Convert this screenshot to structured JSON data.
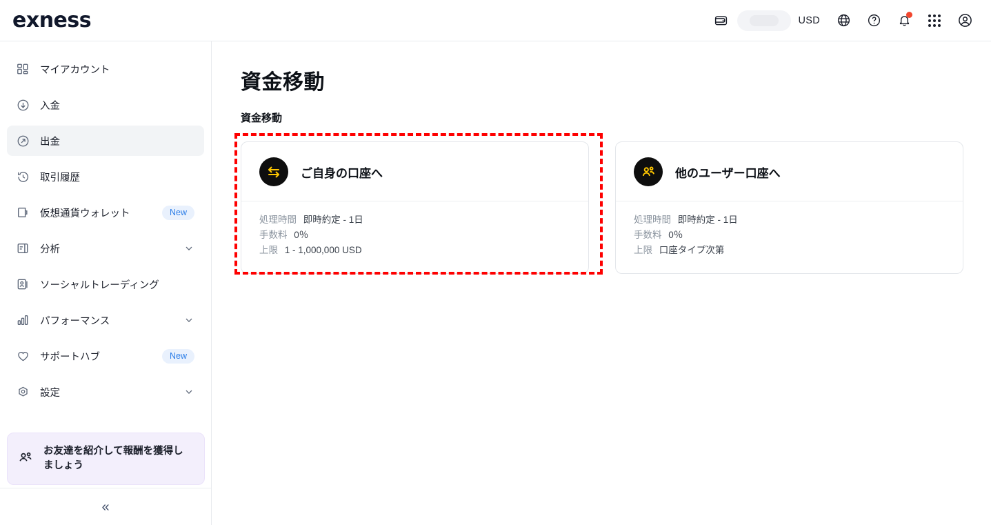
{
  "header": {
    "logo": "exness",
    "currency": "USD",
    "icons": {
      "wallet": "wallet-icon",
      "skeleton": "balance-loading-placeholder",
      "globe": "globe-icon",
      "help": "help-circle-icon",
      "notifications": "bell-icon",
      "apps": "apps-grid-icon",
      "account": "account-avatar-icon"
    }
  },
  "sidebar": {
    "items": [
      {
        "label": "マイアカウント",
        "icon": "dashboard-icon",
        "badge": null,
        "chevron": false,
        "active": false
      },
      {
        "label": "入金",
        "icon": "deposit-arrow-down-icon",
        "badge": null,
        "chevron": false,
        "active": false
      },
      {
        "label": "出金",
        "icon": "withdraw-arrow-up-right-icon",
        "badge": null,
        "chevron": false,
        "active": true
      },
      {
        "label": "取引履歴",
        "icon": "history-clock-icon",
        "badge": null,
        "chevron": false,
        "active": false
      },
      {
        "label": "仮想通貨ウォレット",
        "icon": "crypto-wallet-icon",
        "badge": "New",
        "chevron": false,
        "active": false
      },
      {
        "label": "分析",
        "icon": "analytics-icon",
        "badge": null,
        "chevron": true,
        "active": false
      },
      {
        "label": "ソーシャルトレーディング",
        "icon": "social-trading-icon",
        "badge": null,
        "chevron": false,
        "active": false
      },
      {
        "label": "パフォーマンス",
        "icon": "performance-bars-icon",
        "badge": null,
        "chevron": true,
        "active": false
      },
      {
        "label": "サポートハブ",
        "icon": "heart-icon",
        "badge": "New",
        "chevron": false,
        "active": false
      },
      {
        "label": "設定",
        "icon": "settings-gear-icon",
        "badge": null,
        "chevron": true,
        "active": false
      }
    ],
    "referral": {
      "text": "お友達を紹介して報酬を獲得しましょう",
      "icon": "people-icon"
    },
    "collapse": "«"
  },
  "main": {
    "page_title": "資金移動",
    "section_title": "資金移動",
    "cards": [
      {
        "icon": "transfer-arrows-icon",
        "title": "ご自身の口座へ",
        "details": [
          {
            "label": "処理時間",
            "value": "即時約定 - 1日"
          },
          {
            "label": "手数料",
            "value": "0％"
          },
          {
            "label": "上限",
            "value": "1 - 1,000,000 USD"
          }
        ],
        "highlighted": true
      },
      {
        "icon": "two-people-icon",
        "title": "他のユーザー口座へ",
        "details": [
          {
            "label": "処理時間",
            "value": "即時約定 - 1日"
          },
          {
            "label": "手数料",
            "value": "0％"
          },
          {
            "label": "上限",
            "value": "口座タイプ次第"
          }
        ],
        "highlighted": false
      }
    ]
  },
  "colors": {
    "accent_yellow": "#ffc700",
    "icon_circle_black": "#0e0e0e",
    "badge_blue_bg": "#e9f1fd",
    "badge_blue_text": "#2e7fe8",
    "referral_bg": "#f3effc",
    "active_nav_bg": "#f2f4f6",
    "notification_red": "#f2462e",
    "highlight_red": "#fe0000"
  }
}
